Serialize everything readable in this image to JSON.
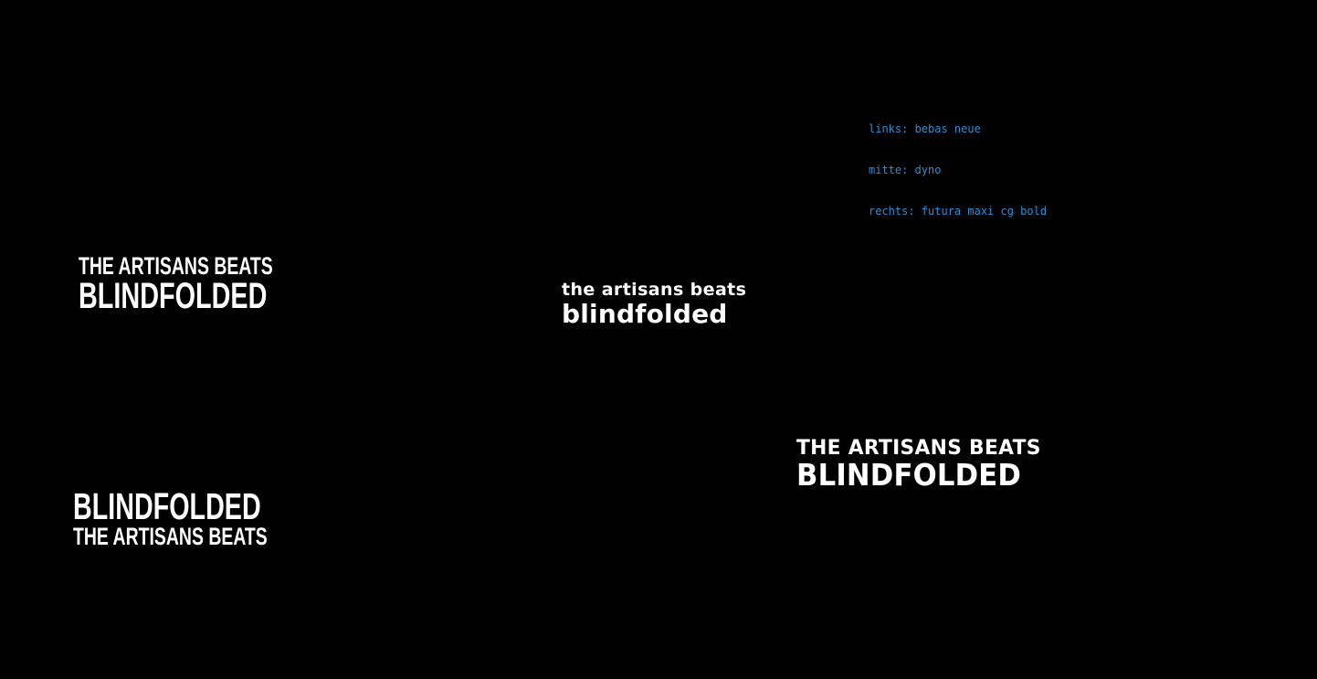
{
  "colors": {
    "background": "#000000",
    "text": "#ffffff",
    "notes": "#2a8fd6"
  },
  "notes": [
    "links: bebas neue",
    "mitte: dyno",
    "rechts: futura maxi cg bold"
  ],
  "samples": {
    "left_top": {
      "line1": "THE ARTISANS BEATS",
      "line2": "BLINDFOLDED"
    },
    "left_bottom": {
      "line1": "BLINDFOLDED",
      "line2": "THE ARTISANS BEATS"
    },
    "middle": {
      "line1": "the artisans beats",
      "line2": "blindfolded"
    },
    "right": {
      "line1": "THE ARTISANS BEATS",
      "line2": "BLINDFOLDED"
    }
  }
}
